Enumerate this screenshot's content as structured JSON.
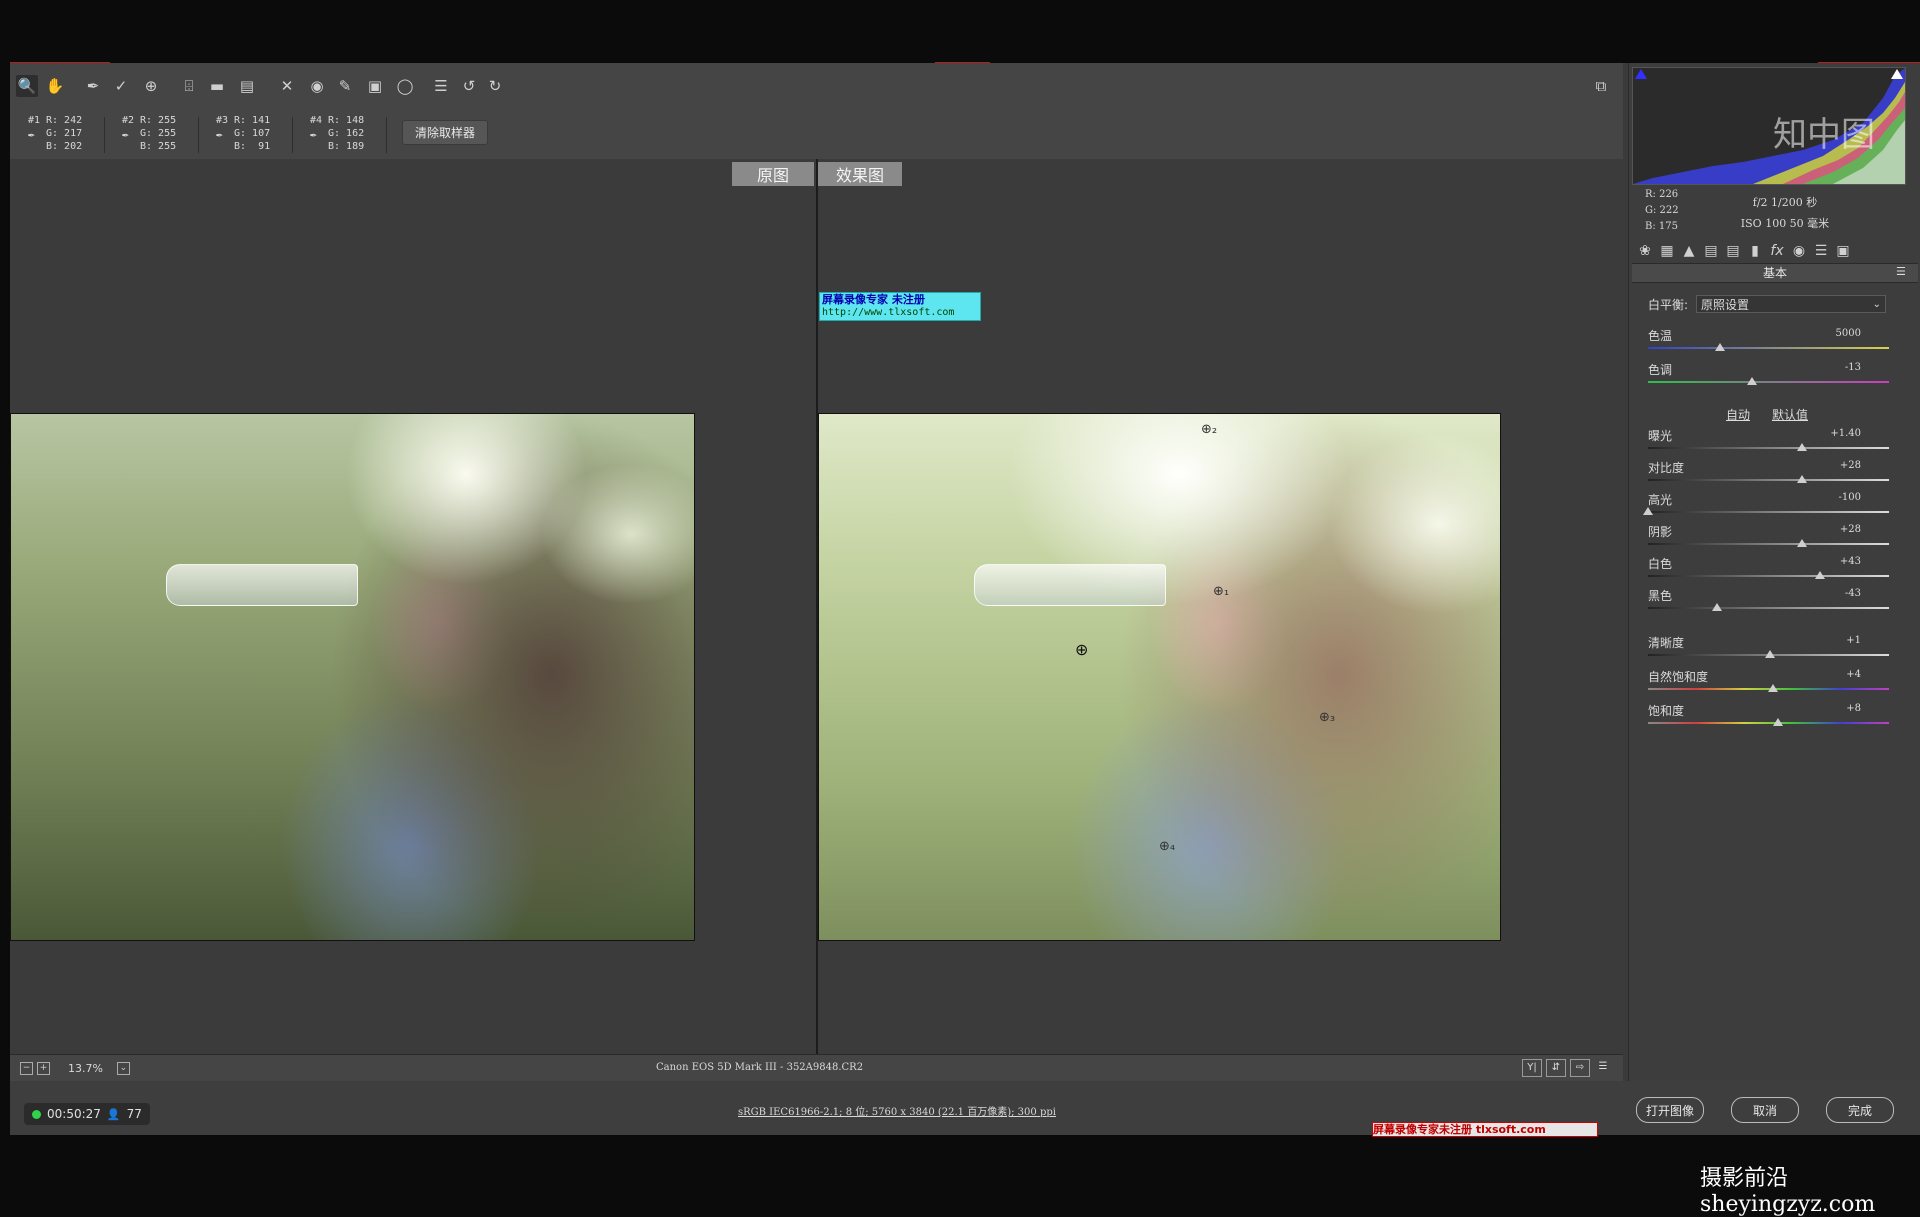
{
  "toolbar": {
    "tools": [
      "zoom-icon",
      "hand-icon",
      "white-balance-icon",
      "color-sampler-icon",
      "targeted-adjustment-icon",
      "crop-icon",
      "straighten-icon",
      "transform-icon",
      "spot-removal-icon",
      "red-eye-icon",
      "adjustment-brush-icon",
      "graduated-filter-icon",
      "radial-filter-icon",
      "list-icon",
      "rotate-left-icon",
      "rotate-right-icon"
    ],
    "clear_samplers": "清除取样器"
  },
  "samplers": [
    {
      "num": "#1",
      "vals": "R: 242\nG: 217\nB: 202"
    },
    {
      "num": "#2",
      "vals": "R: 255\nG: 255\nB: 255"
    },
    {
      "num": "#3",
      "vals": "R: 141\nG: 107\nB:  91"
    },
    {
      "num": "#4",
      "vals": "R: 148\nG: 162\nB: 189"
    }
  ],
  "preview": {
    "before_label": "原图",
    "after_label": "效果图"
  },
  "watermark": {
    "line1": "屏幕录像专家     未注册",
    "line2": "http://www.tlxsoft.com",
    "bottom": "屏幕录像专家未注册 tlxsoft.com"
  },
  "statusbar": {
    "zoom": "13.7%",
    "filename": "Canon EOS 5D Mark III -  352A9848.CR2"
  },
  "footer": {
    "timer": "00:50:27",
    "viewers": "77",
    "workflow": "sRGB IEC61966-2.1; 8 位; 5760 x 3840 (22.1 百万像素); 300 ppi",
    "open_image": "打开图像",
    "cancel": "取消",
    "done": "完成"
  },
  "brand": "摄影前沿sheyingzyz.com",
  "histogram": {
    "rgb": {
      "r": "R: 226",
      "g": "G: 222",
      "b": "B: 175"
    },
    "aperture_shutter": "f/2  1/200 秒",
    "iso_focal": "ISO 100  50 毫米",
    "overlay": "知中图"
  },
  "panel": {
    "title": "基本",
    "white_balance_label": "白平衡:",
    "white_balance_value": "原照设置",
    "auto": "自动",
    "default": "默认值",
    "sliders": [
      {
        "label": "色温",
        "value": "5000",
        "pos": 0.3
      },
      {
        "label": "色调",
        "value": "-13",
        "pos": 0.43
      },
      {
        "label": "曝光",
        "value": "+1.40",
        "pos": 0.64
      },
      {
        "label": "对比度",
        "value": "+28",
        "pos": 0.64
      },
      {
        "label": "高光",
        "value": "-100",
        "pos": 0.0
      },
      {
        "label": "阴影",
        "value": "+28",
        "pos": 0.64
      },
      {
        "label": "白色",
        "value": "+43",
        "pos": 0.715
      },
      {
        "label": "黑色",
        "value": "-43",
        "pos": 0.285
      },
      {
        "label": "清晰度",
        "value": "+1",
        "pos": 0.505
      },
      {
        "label": "自然饱和度",
        "value": "+4",
        "pos": 0.52
      },
      {
        "label": "饱和度",
        "value": "+8",
        "pos": 0.54
      }
    ]
  },
  "colors": {
    "accent": "#b42020",
    "timer_dot": "#2fd44a",
    "watermark_bg": "#5ee6f0"
  }
}
